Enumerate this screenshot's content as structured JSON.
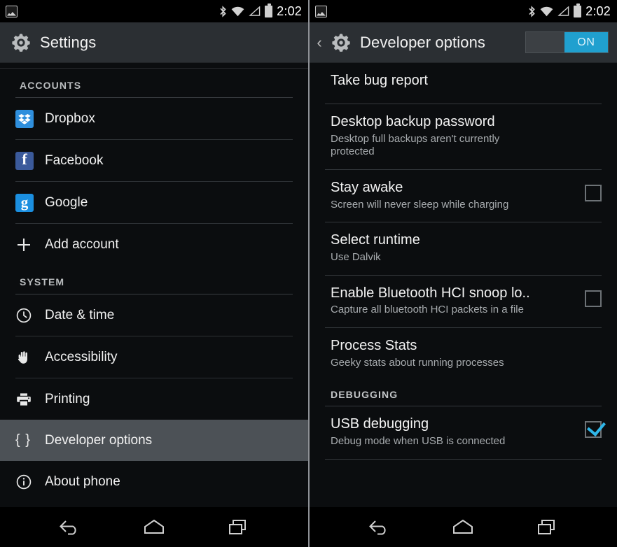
{
  "status_bar": {
    "notification_icon": "screenshot-icon",
    "icons": [
      "bluetooth-icon",
      "wifi-icon",
      "cell-signal-icon",
      "battery-icon"
    ],
    "clock": "2:02"
  },
  "left_screen": {
    "action_bar": {
      "icon": "settings-gear-icon",
      "title": "Settings"
    },
    "sections": [
      {
        "header": "ACCOUNTS",
        "items": [
          {
            "label": "Dropbox",
            "icon": "dropbox-icon",
            "selected": false
          },
          {
            "label": "Facebook",
            "icon": "facebook-icon",
            "selected": false
          },
          {
            "label": "Google",
            "icon": "google-icon",
            "selected": false
          },
          {
            "label": "Add account",
            "icon": "plus-icon",
            "selected": false
          }
        ]
      },
      {
        "header": "SYSTEM",
        "items": [
          {
            "label": "Date & time",
            "icon": "clock-icon",
            "selected": false
          },
          {
            "label": "Accessibility",
            "icon": "hand-icon",
            "selected": false
          },
          {
            "label": "Printing",
            "icon": "printer-icon",
            "selected": false
          },
          {
            "label": "Developer options",
            "icon": "braces-icon",
            "selected": true
          },
          {
            "label": "About phone",
            "icon": "info-icon",
            "selected": false
          }
        ]
      }
    ]
  },
  "right_screen": {
    "action_bar": {
      "back_icon": "back-chevron-icon",
      "icon": "settings-gear-icon",
      "title": "Developer options",
      "toggle_label": "ON",
      "toggle_on": true,
      "toggle_color": "#20a0cf"
    },
    "items": [
      {
        "title": "Take bug report",
        "subtitle": "",
        "control": "none"
      },
      {
        "title": "Desktop backup password",
        "subtitle": "Desktop full backups aren't currently protected",
        "control": "none"
      },
      {
        "title": "Stay awake",
        "subtitle": "Screen will never sleep while charging",
        "control": "checkbox",
        "checked": false
      },
      {
        "title": "Select runtime",
        "subtitle": "Use Dalvik",
        "control": "none"
      },
      {
        "title": "Enable Bluetooth HCI snoop lo..",
        "subtitle": "Capture all bluetooth HCI packets in a file",
        "control": "checkbox",
        "checked": false
      },
      {
        "title": "Process Stats",
        "subtitle": "Geeky stats about running processes",
        "control": "none"
      }
    ],
    "debug_section": {
      "header": "DEBUGGING",
      "items": [
        {
          "title": "USB debugging",
          "subtitle": "Debug mode when USB is connected",
          "control": "checkbox",
          "checked": true
        }
      ]
    }
  },
  "nav_bar": {
    "buttons": [
      "back-icon",
      "home-icon",
      "recents-icon"
    ]
  }
}
